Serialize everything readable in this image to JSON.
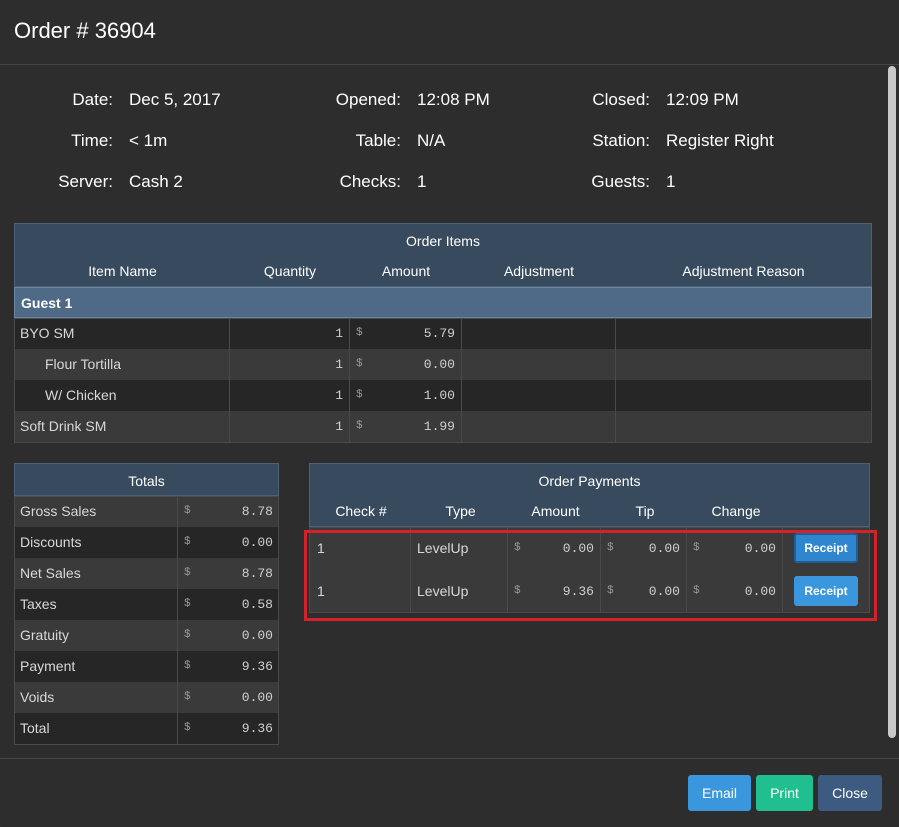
{
  "modal": {
    "title": "Order # 36904"
  },
  "info": {
    "date_label": "Date:",
    "date_value": "Dec 5, 2017",
    "time_label": "Time:",
    "time_value": "< 1m",
    "server_label": "Server:",
    "server_value": "Cash 2",
    "opened_label": "Opened:",
    "opened_value": "12:08 PM",
    "table_label": "Table:",
    "table_value": "N/A",
    "checks_label": "Checks:",
    "checks_value": "1",
    "closed_label": "Closed:",
    "closed_value": "12:09 PM",
    "station_label": "Station:",
    "station_value": "Register Right",
    "guests_label": "Guests:",
    "guests_value": "1"
  },
  "order_items": {
    "title": "Order Items",
    "columns": [
      "Item Name",
      "Quantity",
      "Amount",
      "Adjustment",
      "Adjustment Reason"
    ],
    "guest_label": "Guest 1",
    "rows": [
      {
        "name": "BYO SM",
        "qty": "1",
        "currency": "$",
        "amount": "5.79"
      },
      {
        "name": "Flour Tortilla",
        "qty": "1",
        "currency": "$",
        "amount": "0.00"
      },
      {
        "name": "W/ Chicken",
        "qty": "1",
        "currency": "$",
        "amount": "1.00"
      },
      {
        "name": "Soft Drink SM",
        "qty": "1",
        "currency": "$",
        "amount": "1.99"
      }
    ]
  },
  "totals": {
    "title": "Totals",
    "rows": [
      {
        "label": "Gross Sales",
        "currency": "$",
        "amount": "8.78"
      },
      {
        "label": "Discounts",
        "currency": "$",
        "amount": "0.00"
      },
      {
        "label": "Net Sales",
        "currency": "$",
        "amount": "8.78"
      },
      {
        "label": "Taxes",
        "currency": "$",
        "amount": "0.58"
      },
      {
        "label": "Gratuity",
        "currency": "$",
        "amount": "0.00"
      },
      {
        "label": "Payment",
        "currency": "$",
        "amount": "9.36"
      },
      {
        "label": "Voids",
        "currency": "$",
        "amount": "0.00"
      },
      {
        "label": "Total",
        "currency": "$",
        "amount": "9.36"
      }
    ]
  },
  "payments": {
    "title": "Order Payments",
    "columns": [
      "Check #",
      "Type",
      "Amount",
      "Tip",
      "Change"
    ],
    "receipt_label": "Receipt",
    "rows": [
      {
        "check": "1",
        "type": "LevelUp",
        "currency": "$",
        "amount": "0.00",
        "tip": "0.00",
        "change": "0.00"
      },
      {
        "check": "1",
        "type": "LevelUp",
        "currency": "$",
        "amount": "9.36",
        "tip": "0.00",
        "change": "0.00"
      }
    ]
  },
  "footer": {
    "email_label": "Email",
    "print_label": "Print",
    "close_label": "Close"
  },
  "colors": {
    "highlight": "#d4222a",
    "email": "#3a96dd",
    "print": "#1fbf8f",
    "close": "#3d5a80"
  }
}
